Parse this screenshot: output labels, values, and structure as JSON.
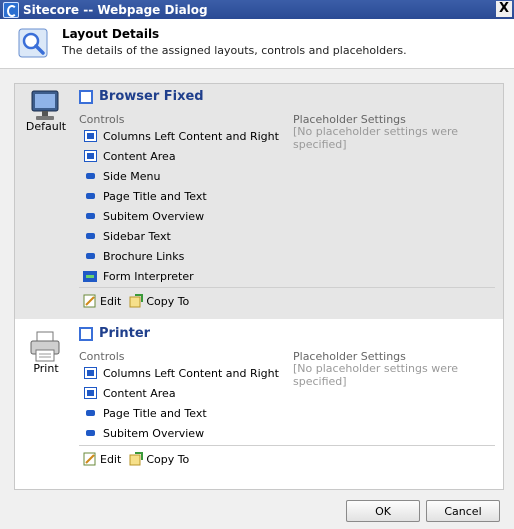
{
  "window": {
    "title": "Sitecore -- Webpage Dialog",
    "close_label": "X"
  },
  "header": {
    "title": "Layout Details",
    "subtitle": "The details of the assigned layouts, controls and placeholders."
  },
  "devices": [
    {
      "name": "Default",
      "layout": "Browser Fixed",
      "controls_heading": "Controls",
      "placeholders_heading": "Placeholder Settings",
      "placeholders_empty": "[No placeholder settings were specified]",
      "controls": [
        {
          "label": "Columns Left Content and Right",
          "icon": "frame-icon"
        },
        {
          "label": "Content Area",
          "icon": "frame-icon"
        },
        {
          "label": "Side Menu",
          "icon": "control-icon"
        },
        {
          "label": "Page Title and Text",
          "icon": "control-icon"
        },
        {
          "label": "Subitem Overview",
          "icon": "control-icon"
        },
        {
          "label": "Sidebar Text",
          "icon": "control-icon"
        },
        {
          "label": "Brochure Links",
          "icon": "control-icon"
        },
        {
          "label": "Form Interpreter",
          "icon": "form-icon"
        }
      ],
      "edit_label": "Edit",
      "copy_label": "Copy To"
    },
    {
      "name": "Print",
      "layout": "Printer",
      "controls_heading": "Controls",
      "placeholders_heading": "Placeholder Settings",
      "placeholders_empty": "[No placeholder settings were specified]",
      "controls": [
        {
          "label": "Columns Left Content and Right",
          "icon": "frame-icon"
        },
        {
          "label": "Content Area",
          "icon": "frame-icon"
        },
        {
          "label": "Page Title and Text",
          "icon": "control-icon"
        },
        {
          "label": "Subitem Overview",
          "icon": "control-icon"
        }
      ],
      "edit_label": "Edit",
      "copy_label": "Copy To"
    }
  ],
  "buttons": {
    "ok": "OK",
    "cancel": "Cancel"
  },
  "colors": {
    "titlebar": "#2a4a94",
    "link_blue": "#1f3f8c",
    "control_blue": "#1f59c6",
    "selected_device_bg": "#e6e6e6"
  }
}
